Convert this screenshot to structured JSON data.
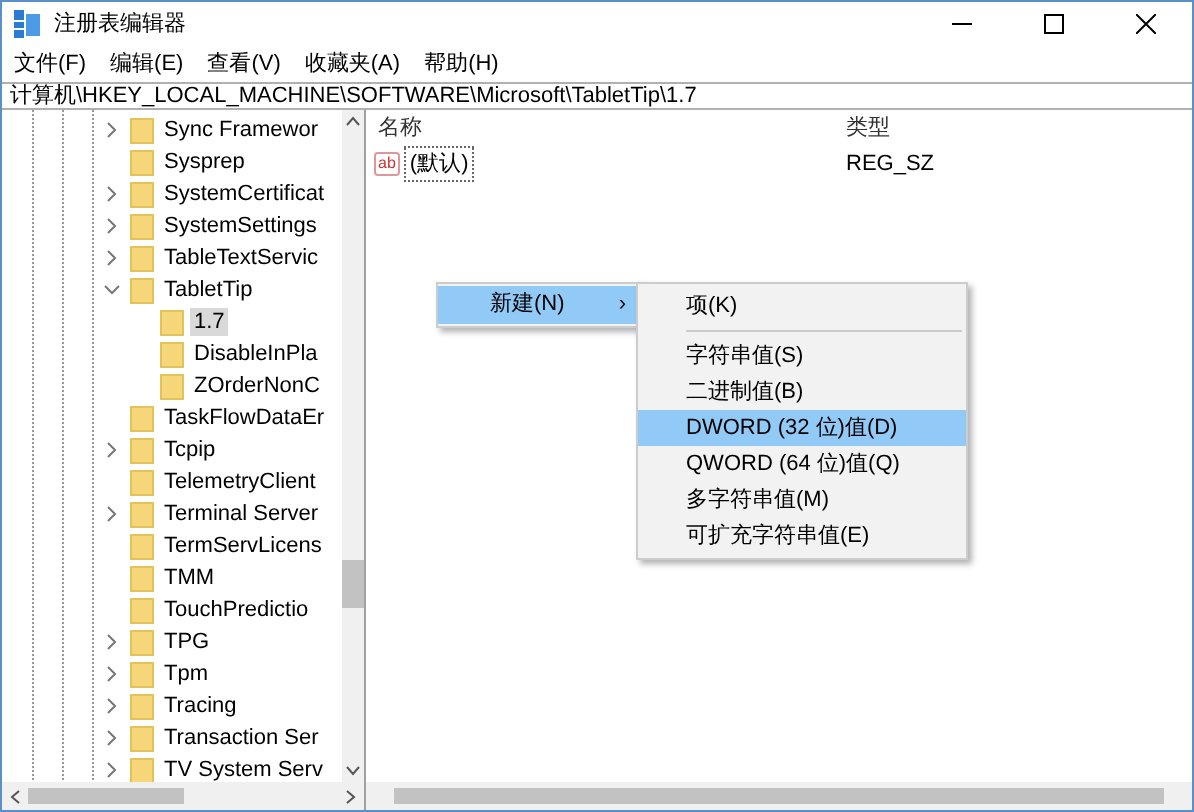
{
  "window": {
    "title": "注册表编辑器"
  },
  "menu": [
    "文件(F)",
    "编辑(E)",
    "查看(V)",
    "收藏夹(A)",
    "帮助(H)"
  ],
  "address": "计算机\\HKEY_LOCAL_MACHINE\\SOFTWARE\\Microsoft\\TabletTip\\1.7",
  "tree": {
    "items": [
      {
        "name": "Sync Framewor",
        "expandable": true,
        "expanded": false,
        "selected": false
      },
      {
        "name": "Sysprep",
        "expandable": false,
        "selected": false
      },
      {
        "name": "SystemCertificat",
        "expandable": true,
        "expanded": false,
        "selected": false
      },
      {
        "name": "SystemSettings",
        "expandable": true,
        "expanded": false,
        "selected": false
      },
      {
        "name": "TableTextServic",
        "expandable": true,
        "expanded": false,
        "selected": false
      },
      {
        "name": "TabletTip",
        "expandable": true,
        "expanded": true,
        "selected": false,
        "children": [
          {
            "name": "1.7",
            "expandable": false,
            "selected": true
          },
          {
            "name": "DisableInPla",
            "expandable": false,
            "selected": false
          },
          {
            "name": "ZOrderNonC",
            "expandable": false,
            "selected": false
          }
        ]
      },
      {
        "name": "TaskFlowDataEr",
        "expandable": false,
        "selected": false
      },
      {
        "name": "Tcpip",
        "expandable": true,
        "expanded": false,
        "selected": false
      },
      {
        "name": "TelemetryClient",
        "expandable": false,
        "selected": false
      },
      {
        "name": "Terminal Server",
        "expandable": true,
        "expanded": false,
        "selected": false
      },
      {
        "name": "TermServLicens",
        "expandable": false,
        "selected": false
      },
      {
        "name": "TMM",
        "expandable": false,
        "selected": false
      },
      {
        "name": "TouchPredictio",
        "expandable": false,
        "selected": false
      },
      {
        "name": "TPG",
        "expandable": true,
        "expanded": false,
        "selected": false
      },
      {
        "name": "Tpm",
        "expandable": true,
        "expanded": false,
        "selected": false
      },
      {
        "name": "Tracing",
        "expandable": true,
        "expanded": false,
        "selected": false
      },
      {
        "name": "Transaction Ser",
        "expandable": true,
        "expanded": false,
        "selected": false
      },
      {
        "name": "TV System Serv",
        "expandable": true,
        "expanded": false,
        "selected": false
      }
    ]
  },
  "values": {
    "columns": [
      "名称",
      "类型"
    ],
    "rows": [
      {
        "icon_text": "ab",
        "name": "(默认)",
        "type": "REG_SZ"
      }
    ]
  },
  "context_menu": {
    "items": [
      {
        "label": "新建(N)",
        "arrow": "›",
        "selected": true
      }
    ]
  },
  "submenu": {
    "items": [
      {
        "kind": "item",
        "label": "项(K)",
        "selected": false
      },
      {
        "kind": "separator"
      },
      {
        "kind": "item",
        "label": "字符串值(S)",
        "selected": false
      },
      {
        "kind": "item",
        "label": "二进制值(B)",
        "selected": false
      },
      {
        "kind": "item",
        "label": "DWORD (32 位)值(D)",
        "selected": true
      },
      {
        "kind": "item",
        "label": "QWORD (64 位)值(Q)",
        "selected": false
      },
      {
        "kind": "item",
        "label": "多字符串值(M)",
        "selected": false
      },
      {
        "kind": "item",
        "label": "可扩充字符串值(E)",
        "selected": false
      }
    ]
  }
}
